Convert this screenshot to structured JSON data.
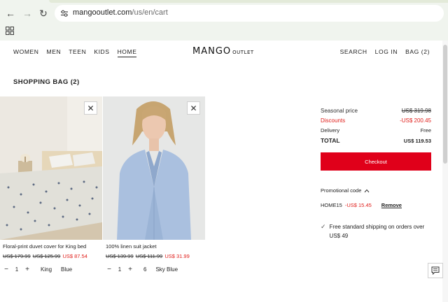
{
  "browser": {
    "url_domain": "mangooutlet.com",
    "url_path": "/us/en/cart",
    "icons": [
      "back-icon",
      "forward-icon",
      "reload-icon",
      "site-settings-icon",
      "apps-icon"
    ]
  },
  "header": {
    "left_nav": [
      "WOMEN",
      "MEN",
      "TEEN",
      "KIDS",
      "HOME"
    ],
    "active_item": "HOME",
    "logo": "MANGO",
    "logo_sub": "OUTLET",
    "right_nav": [
      "SEARCH",
      "LOG IN",
      "BAG (2)"
    ]
  },
  "page_title": "SHOPPING BAG (2)",
  "products": [
    {
      "name": "Floral-print duvet cover for King bed",
      "prices": [
        "US$ 179.99",
        "US$ 125.99"
      ],
      "sale_price": "US$ 87.54",
      "qty": "1",
      "size": "King",
      "color": "Blue"
    },
    {
      "name": "100% linen suit jacket",
      "prices": [
        "US$ 139.99",
        "US$ 111.99"
      ],
      "sale_price": "US$ 31.99",
      "qty": "1",
      "size": "6",
      "color": "Sky Blue"
    }
  ],
  "summary": {
    "seasonal_label": "Seasonal price",
    "seasonal_value": "US$ 319.98",
    "discounts_label": "Discounts",
    "discounts_value": "-US$ 200.45",
    "delivery_label": "Delivery",
    "delivery_value": "Free",
    "total_label": "TOTAL",
    "total_value": "US$ 119.53",
    "checkout_label": "Checkout",
    "promo_label": "Promotional code",
    "promo_code": "HOME15",
    "promo_amount": "-US$ 15.45",
    "remove_label": "Remove",
    "shipping_text": "Free standard shipping on orders over US$ 49"
  },
  "colors": {
    "accent_red": "#e0001a",
    "sale_red": "#e0201c"
  }
}
